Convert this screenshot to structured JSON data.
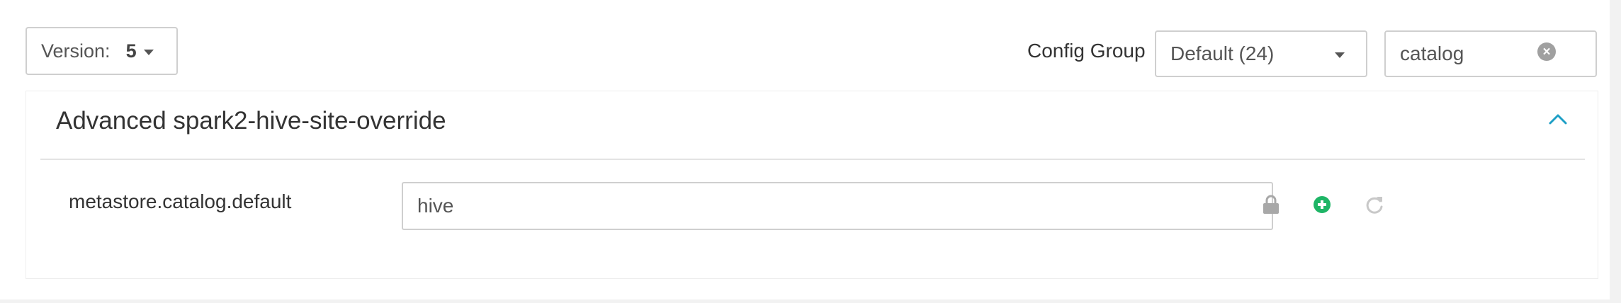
{
  "toolbar": {
    "version_label": "Version:",
    "version_value": "5",
    "config_group_label": "Config Group",
    "config_group_value": "Default (24)",
    "filter_value": "catalog"
  },
  "section": {
    "title": "Advanced spark2-hive-site-override",
    "property": {
      "name": "metastore.catalog.default",
      "value": "hive"
    }
  },
  "colors": {
    "accent": "#1e9fc6",
    "add_green": "#1eb566",
    "muted_icon": "#a8a8a8",
    "border": "#cfcfcf"
  },
  "icons": [
    "caret-down-icon",
    "clear-circle-icon",
    "chevron-up-icon",
    "lock-icon",
    "plus-circle-icon",
    "refresh-icon"
  ]
}
